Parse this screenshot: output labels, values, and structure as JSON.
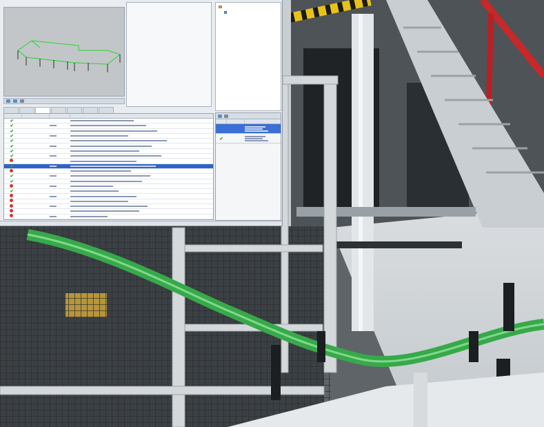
{
  "hmi": {
    "view_panel_title": "",
    "tree": [
      {
        "label": "",
        "kind": "folder"
      },
      {
        "label": "",
        "kind": "leaf"
      }
    ],
    "tabs": [
      {
        "label": ""
      },
      {
        "label": ""
      },
      {
        "label": "",
        "active": true
      },
      {
        "label": ""
      },
      {
        "label": ""
      },
      {
        "label": ""
      },
      {
        "label": ""
      }
    ],
    "events": {
      "columns": [
        "",
        "",
        "",
        ""
      ],
      "rows": [
        {
          "status": "ok",
          "selected": false
        },
        {
          "status": "ok",
          "selected": false
        },
        {
          "status": "ok",
          "selected": false
        },
        {
          "status": "ok",
          "selected": false
        },
        {
          "status": "ok",
          "selected": false
        },
        {
          "status": "ok",
          "selected": false
        },
        {
          "status": "ok",
          "selected": false
        },
        {
          "status": "ok",
          "selected": false
        },
        {
          "status": "alarm",
          "selected": false
        },
        {
          "status": "ok",
          "selected": true
        },
        {
          "status": "alarm",
          "selected": false
        },
        {
          "status": "ok",
          "selected": false
        },
        {
          "status": "ok",
          "selected": false
        },
        {
          "status": "alarm",
          "selected": false
        },
        {
          "status": "ok",
          "selected": false
        },
        {
          "status": "alarm",
          "selected": false
        },
        {
          "status": "alarm",
          "selected": false
        },
        {
          "status": "alarm",
          "selected": false
        },
        {
          "status": "alarm",
          "selected": false
        },
        {
          "status": "alarm",
          "selected": false
        }
      ]
    },
    "alarms": {
      "columns": [
        "",
        "",
        ""
      ],
      "rows": [
        {
          "status": "",
          "selected": true
        },
        {
          "status": "ok",
          "selected": false
        }
      ]
    },
    "statusbar": [
      "",
      "",
      "",
      ""
    ]
  },
  "colors": {
    "selection": "#2f63c9",
    "ok": "#3aa23a",
    "alarm": "#d2362e",
    "model_line": "#3fd24a"
  },
  "icons": [
    "checkmark-icon",
    "alarm-icon",
    "folder-icon",
    "node-icon"
  ]
}
